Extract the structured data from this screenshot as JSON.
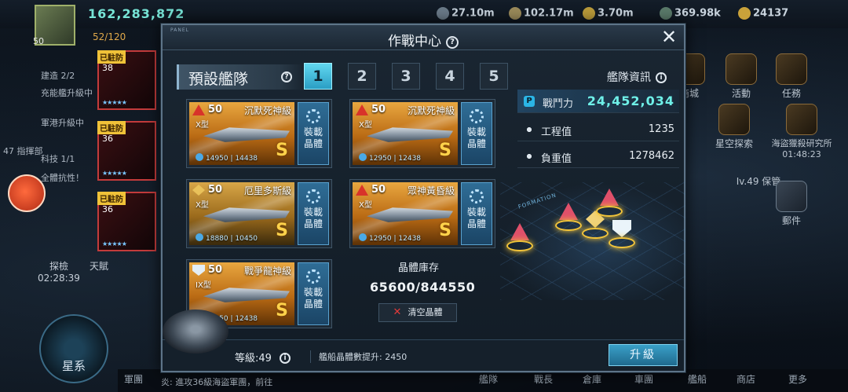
{
  "hud": {
    "power_top": "162,283,872",
    "player_level": "50",
    "stamina": "52/120",
    "res_1": "27.10m",
    "res_2": "102.17m",
    "res_3": "3.70m",
    "res_4": "369.98k",
    "res_5": "24137",
    "left_texts": [
      "建造 2/2",
      "充能艦升級中",
      "軍港升級中",
      "47 指揮部",
      "科技 1/1",
      "全體抗性！"
    ],
    "explore_label": "探檢",
    "explore_timer": "02:28:39",
    "talent_label": "天賦",
    "galaxy_label": "星系",
    "right_labels": [
      "商城",
      "活動",
      "任務",
      "星空探索",
      "海盜獵殺研究所",
      "Iv.49 保管",
      "郵件"
    ],
    "right_timer": "01:48:23",
    "bottom_labels": [
      "軍團",
      "艦隊",
      "戰長",
      "倉庫",
      "車團",
      "艦船",
      "商店",
      "更多"
    ],
    "chat": "炎: 進攻36級海盜軍團，前往"
  },
  "heroes": [
    {
      "tag": "已駐防",
      "level": "38",
      "stars": "★★★★★"
    },
    {
      "tag": "已駐防",
      "level": "36",
      "stars": "★★★★★"
    },
    {
      "tag": "已駐防",
      "level": "36",
      "stars": "★★★★★"
    }
  ],
  "panel": {
    "tiny_label": "PANEL",
    "title": "作戰中心",
    "close_glyph": "✕",
    "preset_label": "預設艦隊",
    "tabs": [
      "1",
      "2",
      "3",
      "4",
      "5"
    ],
    "active_tab": "1",
    "fleet_info_title": "艦隊資訊",
    "info": {
      "power_label": "戰鬥力",
      "power_value": "24,452,034",
      "engineering_label": "工程值",
      "engineering_value": "1235",
      "load_label": "負重值",
      "load_value": "1278462"
    },
    "equip_label_1": "裝載",
    "equip_label_2": "晶體",
    "ships": [
      {
        "level": "50",
        "name": "沉默死神級",
        "type": "X型",
        "stat": "14950 | 14438",
        "grade": "S",
        "icon": "red-triangle-icon"
      },
      {
        "level": "50",
        "name": "沉默死神級",
        "type": "X型",
        "stat": "12950 | 12438",
        "grade": "S",
        "icon": "red-triangle-icon"
      },
      {
        "level": "50",
        "name": "厄里多斯級",
        "type": "X型",
        "stat": "18880 | 10450",
        "grade": "S",
        "icon": "gold-diamond-icon"
      },
      {
        "level": "50",
        "name": "眾神黃昏級",
        "type": "X型",
        "stat": "12950 | 12438",
        "grade": "S",
        "icon": "red-triangle-icon"
      },
      {
        "level": "50",
        "name": "戰爭龍神級",
        "type": "IX型",
        "stat": "12950 | 12438",
        "grade": "S",
        "icon": "shield-icon"
      }
    ],
    "stock_title": "晶體庫存",
    "stock_value": "65600/844550",
    "clear_label": "清空晶體",
    "formation_tag": "FORMATION",
    "level_text": "等級:49",
    "boost_text": "艦船晶體數提升: 2450",
    "upgrade_label": "升級"
  },
  "colors": {
    "accent_cyan": "#62d8f0",
    "power_value": "#6ff0e8",
    "grade_gold": "#ffd24a",
    "clear_x": "#e23a3a"
  }
}
